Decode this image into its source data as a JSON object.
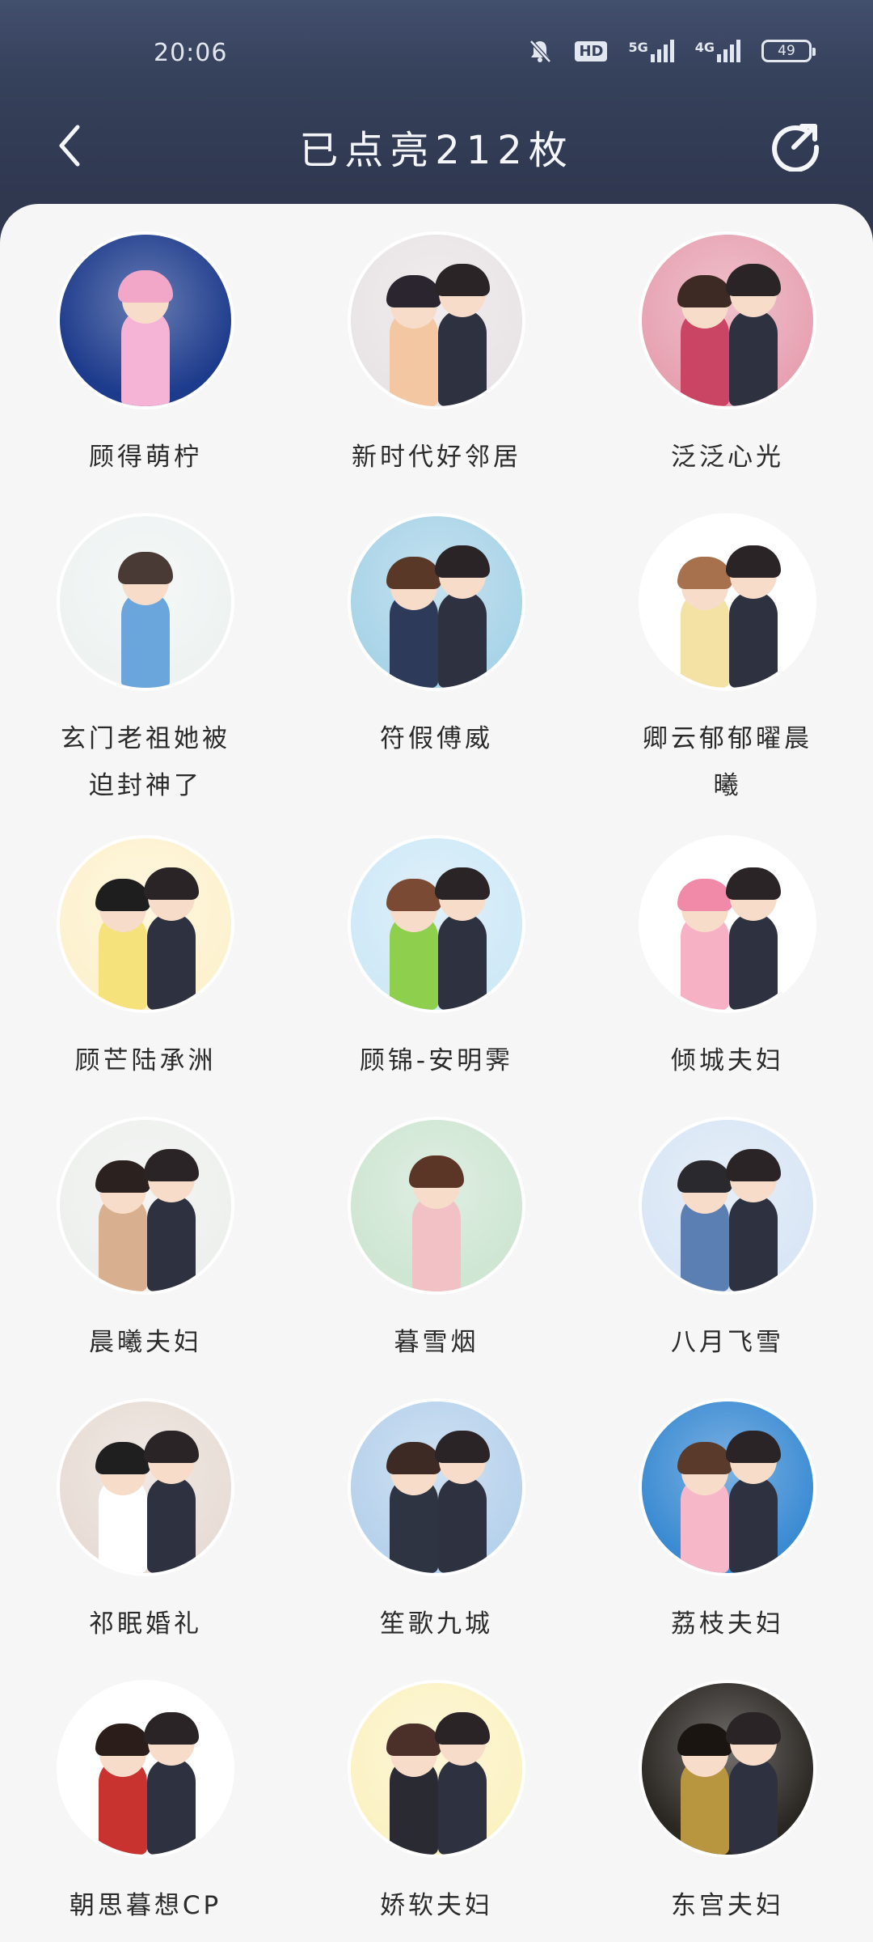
{
  "status_bar": {
    "time": "20:06",
    "battery_level": "49",
    "network_1": "5G",
    "network_2": "4G",
    "hd_badge": "HD"
  },
  "nav": {
    "back_icon": "chevron-left-icon",
    "title": "已点亮212枚",
    "share_icon": "share-icon"
  },
  "badges": [
    {
      "name": "顾得萌柠",
      "bg": "#1d3b8c",
      "accent": "#f5b3d6",
      "hair": "#f2a6c8",
      "second": false
    },
    {
      "name": "新时代好邻居",
      "bg": "#e9e4e6",
      "accent": "#f4c7a3",
      "hair": "#2b2530",
      "second": true
    },
    {
      "name": "泛泛心光",
      "bg": "#e7a2b2",
      "accent": "#c94563",
      "hair": "#3d2a24",
      "second": true
    },
    {
      "name": "玄门老祖她被迫封神了",
      "bg": "#eef3f2",
      "accent": "#6aa6db",
      "hair": "#4a3a35",
      "second": false
    },
    {
      "name": "符假傅威",
      "bg": "#a9d4e8",
      "accent": "#2d3a5a",
      "hair": "#5a3828",
      "second": true
    },
    {
      "name": "卿云郁郁曜晨曦",
      "bg": "#ffffff",
      "accent": "#f3e2a4",
      "hair": "#a8714e",
      "second": true
    },
    {
      "name": "顾芒陆承洲",
      "bg": "#fdf2cf",
      "accent": "#f6e27a",
      "hair": "#1e1e1e",
      "second": true
    },
    {
      "name": "顾锦-安明霁",
      "bg": "#cfe9f7",
      "accent": "#8fcf4e",
      "hair": "#7b4a34",
      "second": true
    },
    {
      "name": "倾城夫妇",
      "bg": "#ffffff",
      "accent": "#f7b1c4",
      "hair": "#f08aa8",
      "second": true
    },
    {
      "name": "晨曦夫妇",
      "bg": "#eef0ee",
      "accent": "#d8b08f",
      "hair": "#2b2220",
      "second": true
    },
    {
      "name": "暮雪烟",
      "bg": "#cfe6d3",
      "accent": "#f2c1c5",
      "hair": "#5b3626",
      "second": false
    },
    {
      "name": "八月飞雪",
      "bg": "#d9e6f5",
      "accent": "#5b7fb3",
      "hair": "#2a2a2e",
      "second": true
    },
    {
      "name": "祁眠婚礼",
      "bg": "#e8ddd6",
      "accent": "#ffffff",
      "hair": "#1f1f1f",
      "second": true
    },
    {
      "name": "笙歌九城",
      "bg": "#b7d2ec",
      "accent": "#2f3443",
      "hair": "#3d2a24",
      "second": true
    },
    {
      "name": "荔枝夫妇",
      "bg": "#3b8bd3",
      "accent": "#f6b8c8",
      "hair": "#5a3a2a",
      "second": true
    },
    {
      "name": "朝思暮想CP",
      "bg": "#ffffff",
      "accent": "#c8332f",
      "hair": "#2a1d1a",
      "second": true
    },
    {
      "name": "娇软夫妇",
      "bg": "#fbf2c4",
      "accent": "#2a2a33",
      "hair": "#4a3028",
      "second": true
    },
    {
      "name": "东宫夫妇",
      "bg": "#2a2622",
      "accent": "#b8953f",
      "hair": "#1b1512",
      "second": true
    }
  ]
}
